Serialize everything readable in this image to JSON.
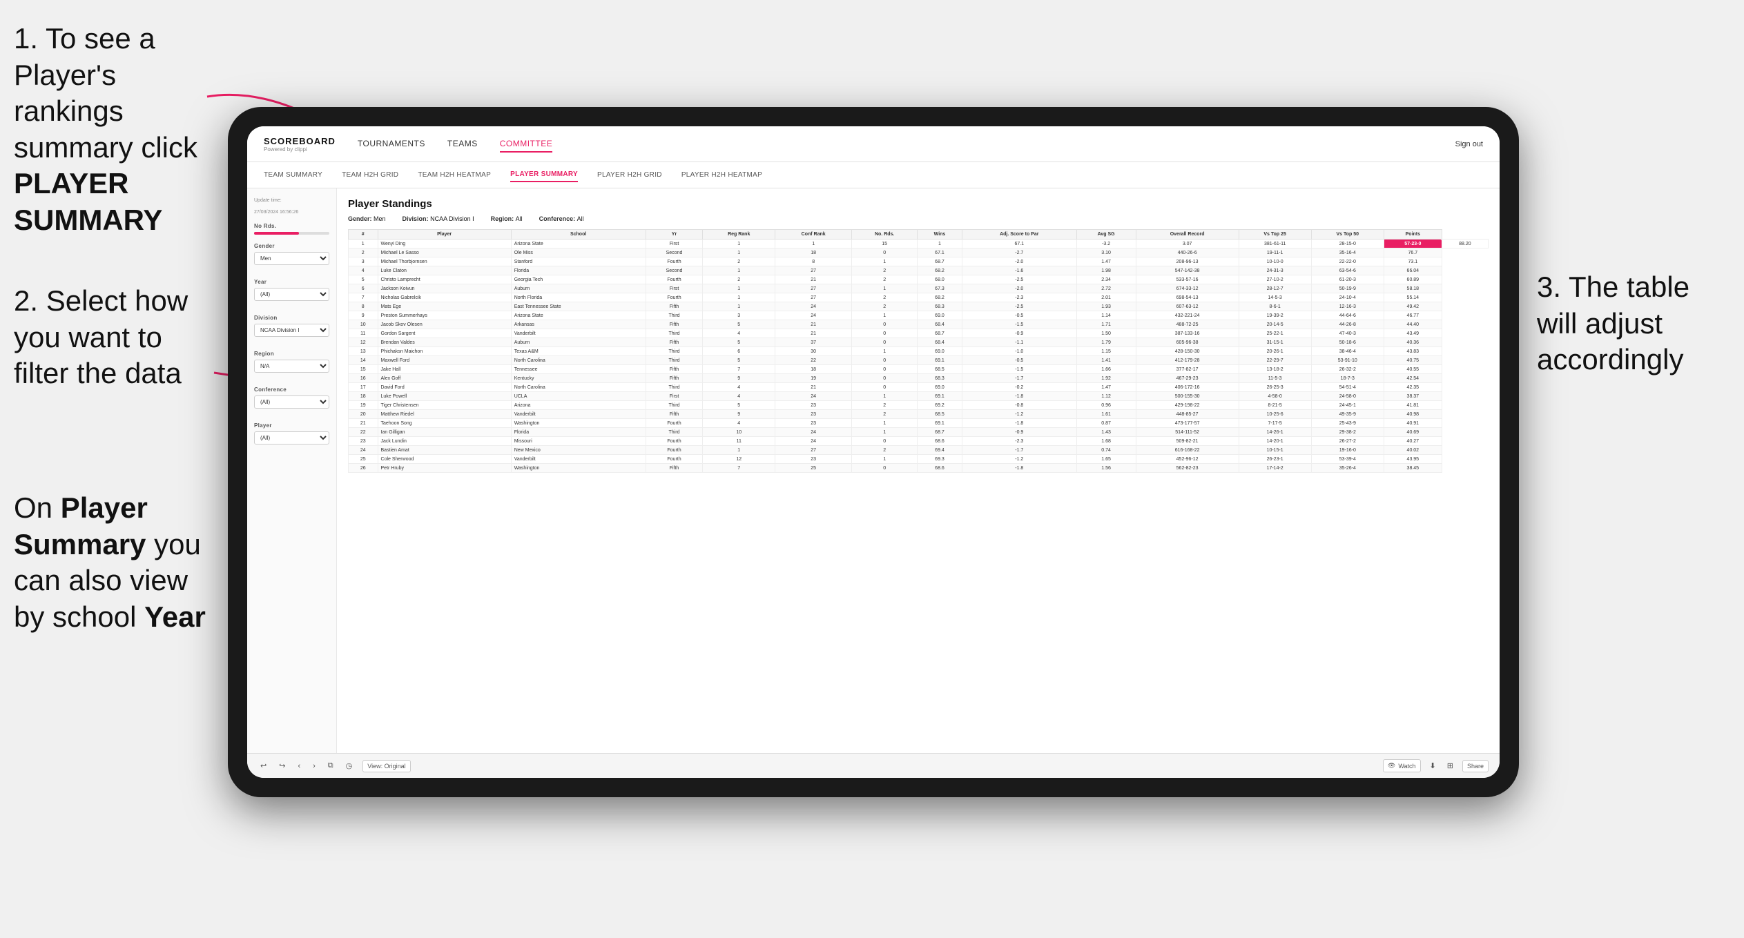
{
  "annotations": {
    "step1": "1. To see a Player's rankings summary click ",
    "step1_bold": "PLAYER SUMMARY",
    "step2_title": "2. Select how you want to filter the data",
    "step3_title": "3. The table will adjust accordingly",
    "step_bottom": "On ",
    "step_bottom_bold1": "Player Summary",
    "step_bottom_mid": " you can also view by school ",
    "step_bottom_bold2": "Year"
  },
  "nav": {
    "logo": "SCOREBOARD",
    "logo_sub": "Powered by clippi",
    "links": [
      "TOURNAMENTS",
      "TEAMS",
      "COMMITTEE"
    ],
    "active_link": "COMMITTEE",
    "sign_out": "Sign out"
  },
  "sub_nav": {
    "links": [
      "TEAM SUMMARY",
      "TEAM H2H GRID",
      "TEAM H2H HEATMAP",
      "PLAYER SUMMARY",
      "PLAYER H2H GRID",
      "PLAYER H2H HEATMAP"
    ],
    "active": "PLAYER SUMMARY"
  },
  "sidebar": {
    "update_label": "Update time:",
    "update_time": "27/03/2024 16:56:26",
    "no_rds_label": "No Rds.",
    "gender_label": "Gender",
    "gender_val": "Men",
    "year_label": "Year",
    "year_val": "(All)",
    "division_label": "Division",
    "division_val": "NCAA Division I",
    "region_label": "Region",
    "region_val": "N/A",
    "conference_label": "Conference",
    "conference_val": "(All)",
    "player_label": "Player",
    "player_val": "(All)"
  },
  "table": {
    "title": "Player Standings",
    "filters": {
      "gender_label": "Gender:",
      "gender_val": "Men",
      "division_label": "Division:",
      "division_val": "NCAA Division I",
      "region_label": "Region:",
      "region_val": "All",
      "conference_label": "Conference:",
      "conference_val": "All"
    },
    "headers": [
      "#",
      "Player",
      "School",
      "Yr",
      "Reg Rank",
      "Conf Rank",
      "No. Rds.",
      "Wins",
      "Adj. Score to Par",
      "Avg SG",
      "Overall Record",
      "Vs Top 25",
      "Vs Top 50",
      "Points"
    ],
    "rows": [
      [
        "1",
        "Wenyi Ding",
        "Arizona State",
        "First",
        "1",
        "1",
        "15",
        "1",
        "67.1",
        "-3.2",
        "3.07",
        "381-61-11",
        "28-15-0",
        "57-23-0",
        "88.20"
      ],
      [
        "2",
        "Michael Le Sasso",
        "Ole Miss",
        "Second",
        "1",
        "18",
        "0",
        "67.1",
        "-2.7",
        "3.10",
        "440-26-6",
        "19-11-1",
        "35-16-4",
        "76.7"
      ],
      [
        "3",
        "Michael Thorbjornsen",
        "Stanford",
        "Fourth",
        "2",
        "8",
        "1",
        "68.7",
        "-2.0",
        "1.47",
        "208-96-13",
        "10-10-0",
        "22-22-0",
        "73.1"
      ],
      [
        "4",
        "Luke Claton",
        "Florida",
        "Second",
        "1",
        "27",
        "2",
        "68.2",
        "-1.6",
        "1.98",
        "547-142-38",
        "24-31-3",
        "63-54-6",
        "66.04"
      ],
      [
        "5",
        "Christo Lamprecht",
        "Georgia Tech",
        "Fourth",
        "2",
        "21",
        "2",
        "68.0",
        "-2.5",
        "2.34",
        "533-57-16",
        "27-10-2",
        "61-20-3",
        "60.89"
      ],
      [
        "6",
        "Jackson Koivun",
        "Auburn",
        "First",
        "1",
        "27",
        "1",
        "67.3",
        "-2.0",
        "2.72",
        "674-33-12",
        "28-12-7",
        "50-19-9",
        "58.18"
      ],
      [
        "7",
        "Nicholas Gabrelcik",
        "North Florida",
        "Fourth",
        "1",
        "27",
        "2",
        "68.2",
        "-2.3",
        "2.01",
        "698-54-13",
        "14-5-3",
        "24-10-4",
        "55.14"
      ],
      [
        "8",
        "Mats Ege",
        "East Tennessee State",
        "Fifth",
        "1",
        "24",
        "2",
        "68.3",
        "-2.5",
        "1.93",
        "607-63-12",
        "8-6-1",
        "12-16-3",
        "49.42"
      ],
      [
        "9",
        "Preston Summerhays",
        "Arizona State",
        "Third",
        "3",
        "24",
        "1",
        "69.0",
        "-0.5",
        "1.14",
        "432-221-24",
        "19-39-2",
        "44-64-6",
        "46.77"
      ],
      [
        "10",
        "Jacob Skov Olesen",
        "Arkansas",
        "Fifth",
        "5",
        "21",
        "0",
        "68.4",
        "-1.5",
        "1.71",
        "488-72-25",
        "20-14-5",
        "44-26-8",
        "44.40"
      ],
      [
        "11",
        "Gordon Sargent",
        "Vanderbilt",
        "Third",
        "4",
        "21",
        "0",
        "68.7",
        "-0.9",
        "1.50",
        "387-133-16",
        "25-22-1",
        "47-40-3",
        "43.49"
      ],
      [
        "12",
        "Brendan Valdes",
        "Auburn",
        "Fifth",
        "5",
        "37",
        "0",
        "68.4",
        "-1.1",
        "1.79",
        "605-96-38",
        "31-15-1",
        "50-18-6",
        "40.36"
      ],
      [
        "13",
        "Phichaksn Maichon",
        "Texas A&M",
        "Third",
        "6",
        "30",
        "1",
        "69.0",
        "-1.0",
        "1.15",
        "428-150-30",
        "20-26-1",
        "38-46-4",
        "43.83"
      ],
      [
        "14",
        "Maxwell Ford",
        "North Carolina",
        "Third",
        "5",
        "22",
        "0",
        "69.1",
        "-0.5",
        "1.41",
        "412-179-28",
        "22-29-7",
        "53-91-10",
        "40.75"
      ],
      [
        "15",
        "Jake Hall",
        "Tennessee",
        "Fifth",
        "7",
        "18",
        "0",
        "68.5",
        "-1.5",
        "1.66",
        "377-82-17",
        "13-18-2",
        "26-32-2",
        "40.55"
      ],
      [
        "16",
        "Alex Goff",
        "Kentucky",
        "Fifth",
        "9",
        "19",
        "0",
        "68.3",
        "-1.7",
        "1.92",
        "467-29-23",
        "11-5-3",
        "18-7-3",
        "42.54"
      ],
      [
        "17",
        "David Ford",
        "North Carolina",
        "Third",
        "4",
        "21",
        "0",
        "69.0",
        "-0.2",
        "1.47",
        "406-172-16",
        "26-25-3",
        "54-51-4",
        "42.35"
      ],
      [
        "18",
        "Luke Powell",
        "UCLA",
        "First",
        "4",
        "24",
        "1",
        "69.1",
        "-1.8",
        "1.12",
        "500-155-30",
        "4-58-0",
        "24-58-0",
        "38.37"
      ],
      [
        "19",
        "Tiger Christensen",
        "Arizona",
        "Third",
        "5",
        "23",
        "2",
        "69.2",
        "-0.8",
        "0.96",
        "429-198-22",
        "8-21-5",
        "24-45-1",
        "41.81"
      ],
      [
        "20",
        "Matthew Riedel",
        "Vanderbilt",
        "Fifth",
        "9",
        "23",
        "2",
        "68.5",
        "-1.2",
        "1.61",
        "448-85-27",
        "10-25-6",
        "49-35-9",
        "40.98"
      ],
      [
        "21",
        "Taehoon Song",
        "Washington",
        "Fourth",
        "4",
        "23",
        "1",
        "69.1",
        "-1.8",
        "0.87",
        "473-177-57",
        "7-17-5",
        "25-43-9",
        "40.91"
      ],
      [
        "22",
        "Ian Gilligan",
        "Florida",
        "Third",
        "10",
        "24",
        "1",
        "68.7",
        "-0.9",
        "1.43",
        "514-111-52",
        "14-26-1",
        "29-38-2",
        "40.69"
      ],
      [
        "23",
        "Jack Lundin",
        "Missouri",
        "Fourth",
        "11",
        "24",
        "0",
        "68.6",
        "-2.3",
        "1.68",
        "509-82-21",
        "14-20-1",
        "26-27-2",
        "40.27"
      ],
      [
        "24",
        "Bastien Amat",
        "New Mexico",
        "Fourth",
        "1",
        "27",
        "2",
        "69.4",
        "-1.7",
        "0.74",
        "616-168-22",
        "10-15-1",
        "19-16-0",
        "40.02"
      ],
      [
        "25",
        "Cole Sherwood",
        "Vanderbilt",
        "Fourth",
        "12",
        "23",
        "1",
        "69.3",
        "-1.2",
        "1.65",
        "452-96-12",
        "26-23-1",
        "53-39-4",
        "43.95"
      ],
      [
        "26",
        "Petr Hruby",
        "Washington",
        "Fifth",
        "7",
        "25",
        "0",
        "68.6",
        "-1.8",
        "1.56",
        "562-82-23",
        "17-14-2",
        "35-26-4",
        "38.45"
      ]
    ]
  },
  "toolbar": {
    "view_label": "View: Original",
    "watch_label": "Watch",
    "share_label": "Share"
  },
  "colors": {
    "accent": "#e91e63",
    "highlight": "#e91e63"
  }
}
